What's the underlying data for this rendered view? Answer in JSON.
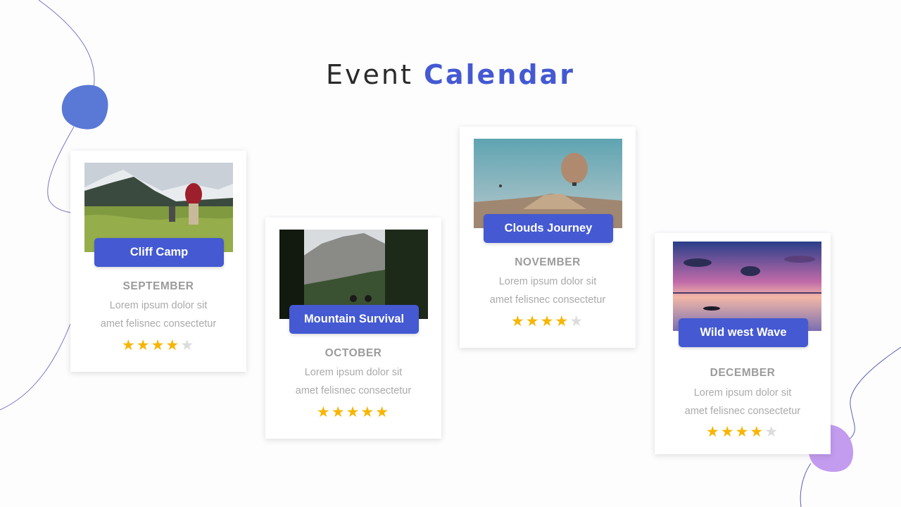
{
  "header": {
    "title_light": "Event",
    "title_bold": "Calendar"
  },
  "colors": {
    "accent": "#4459d2",
    "blob_blue": "#5a78d6",
    "blob_purple": "#c39bef",
    "star_on": "#f7b500",
    "star_off": "#dcdcdc",
    "muted_text": "#9b9b9b"
  },
  "events": [
    {
      "name": "Cliff Camp",
      "month": "SEPTEMBER",
      "desc_line1": "Lorem ipsum dolor sit",
      "desc_line2": "amet felisnec consectetur",
      "rating": 4,
      "rating_max": 5,
      "image": "mountain-hikers-photo"
    },
    {
      "name": "Mountain Survival",
      "month": "OCTOBER",
      "desc_line1": "Lorem ipsum dolor sit",
      "desc_line2": "amet felisnec consectetur",
      "rating": 5,
      "rating_max": 5,
      "image": "forest-mountain-photo"
    },
    {
      "name": "Clouds Journey",
      "month": "NOVEMBER",
      "desc_line1": "Lorem ipsum dolor sit",
      "desc_line2": "amet felisnec consectetur",
      "rating": 4,
      "rating_max": 5,
      "image": "hot-air-balloon-photo"
    },
    {
      "name": "Wild west Wave",
      "month": "DECEMBER",
      "desc_line1": "Lorem ipsum dolor sit",
      "desc_line2": "amet felisnec consectetur",
      "rating": 4,
      "rating_max": 5,
      "image": "sunset-lake-photo"
    }
  ]
}
